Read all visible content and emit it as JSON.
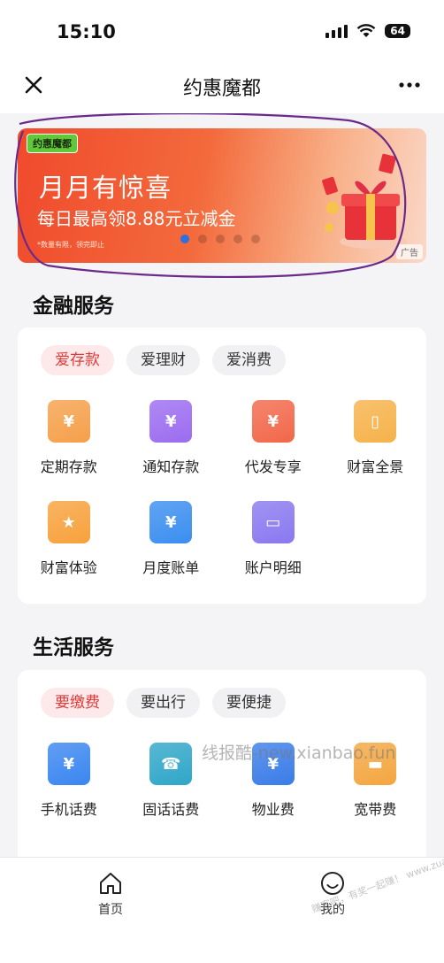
{
  "status_bar": {
    "time": "15:10",
    "battery": "64"
  },
  "nav": {
    "title": "约惠魔都"
  },
  "banner": {
    "logo": "约惠魔都",
    "headline": "月月有惊喜",
    "subline": "每日最高领8.88元立减金",
    "note": "*数量有限，领完即止",
    "ad_label": "广告",
    "dot_count": 5,
    "active_dot": 0
  },
  "finance": {
    "title": "金融服务",
    "chips": [
      "爱存款",
      "爱理财",
      "爱消费"
    ],
    "active_chip": 0,
    "items": [
      {
        "label": "定期存款",
        "icon": "fixed-deposit-icon",
        "color": "#f5a04a",
        "glyph": "¥"
      },
      {
        "label": "通知存款",
        "icon": "notice-deposit-icon",
        "color": "#9b6cf0",
        "glyph": "¥"
      },
      {
        "label": "代发专享",
        "icon": "payroll-icon",
        "color": "#f2674a",
        "glyph": "¥"
      },
      {
        "label": "财富全景",
        "icon": "wealth-map-icon",
        "color": "#f6b24a",
        "glyph": "▯"
      },
      {
        "label": "财富体验",
        "icon": "wealth-experience-icon",
        "color": "#f7a13c",
        "glyph": "★"
      },
      {
        "label": "月度账单",
        "icon": "monthly-bill-icon",
        "color": "#3a8ef0",
        "glyph": "¥"
      },
      {
        "label": "账户明细",
        "icon": "account-detail-icon",
        "color": "#8a78f0",
        "glyph": "▭"
      }
    ]
  },
  "life": {
    "title": "生活服务",
    "chips": [
      "要缴费",
      "要出行",
      "要便捷"
    ],
    "active_chip": 0,
    "items": [
      {
        "label": "手机话费",
        "icon": "mobile-bill-icon",
        "color": "#3a86f0",
        "glyph": "¥"
      },
      {
        "label": "固话话费",
        "icon": "landline-icon",
        "color": "#2fa6c8",
        "glyph": "☎"
      },
      {
        "label": "物业费",
        "icon": "property-fee-icon",
        "color": "#3a7ce8",
        "glyph": "¥"
      },
      {
        "label": "宽带费",
        "icon": "broadband-icon",
        "color": "#f3a640",
        "glyph": "▬"
      }
    ]
  },
  "watermark": {
    "text": "线报酷-new.xianbao.fun",
    "corner": "赚客吧，有奖一起赚！ www.zuanke8.com"
  },
  "tabs": [
    {
      "label": "首页",
      "icon": "home-icon"
    },
    {
      "label": "我的",
      "icon": "profile-icon"
    }
  ]
}
